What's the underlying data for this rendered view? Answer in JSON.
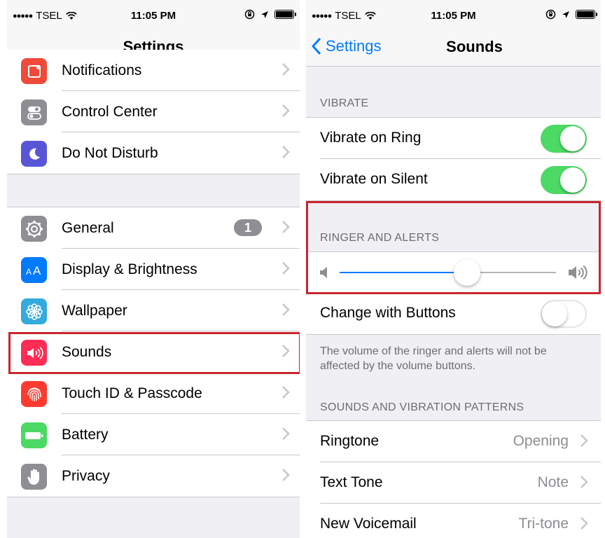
{
  "status_bar": {
    "carrier": "TSEL",
    "time": "11:05 PM"
  },
  "left": {
    "title": "Settings",
    "group1": [
      {
        "label": "Notifications",
        "icon": "notifications-icon",
        "color": "#f04a3a"
      },
      {
        "label": "Control Center",
        "icon": "switches-icon",
        "color": "#8e8e93"
      },
      {
        "label": "Do Not Disturb",
        "icon": "moon-icon",
        "color": "#5856d6"
      }
    ],
    "group2": [
      {
        "label": "General",
        "icon": "gear-icon",
        "color": "#8e8e93",
        "badge": "1"
      },
      {
        "label": "Display & Brightness",
        "icon": "text-size-icon",
        "color": "#007aff"
      },
      {
        "label": "Wallpaper",
        "icon": "flower-icon",
        "color": "#35aadc"
      },
      {
        "label": "Sounds",
        "icon": "speaker-icon",
        "color": "#ff2d55"
      },
      {
        "label": "Touch ID & Passcode",
        "icon": "fingerprint-icon",
        "color": "#ff3b30"
      },
      {
        "label": "Battery",
        "icon": "battery-icon",
        "color": "#4cd964"
      },
      {
        "label": "Privacy",
        "icon": "hand-icon",
        "color": "#8e8e93"
      }
    ]
  },
  "right": {
    "back_label": "Settings",
    "title": "Sounds",
    "vibrate_header": "VIBRATE",
    "vibrate_on_ring": {
      "label": "Vibrate on Ring",
      "on": true
    },
    "vibrate_on_silent": {
      "label": "Vibrate on Silent",
      "on": true
    },
    "ringer_header": "RINGER AND ALERTS",
    "ringer_volume": 0.59,
    "change_with_buttons": {
      "label": "Change with Buttons",
      "on": false
    },
    "footer": "The volume of the ringer and alerts will not be affected by the volume buttons.",
    "patterns_header": "SOUNDS AND VIBRATION PATTERNS",
    "patterns": [
      {
        "label": "Ringtone",
        "value": "Opening"
      },
      {
        "label": "Text Tone",
        "value": "Note"
      },
      {
        "label": "New Voicemail",
        "value": "Tri-tone"
      }
    ]
  },
  "colors": {
    "accent": "#007aff",
    "switch_on": "#4cd964",
    "highlight": "#c9252f"
  }
}
